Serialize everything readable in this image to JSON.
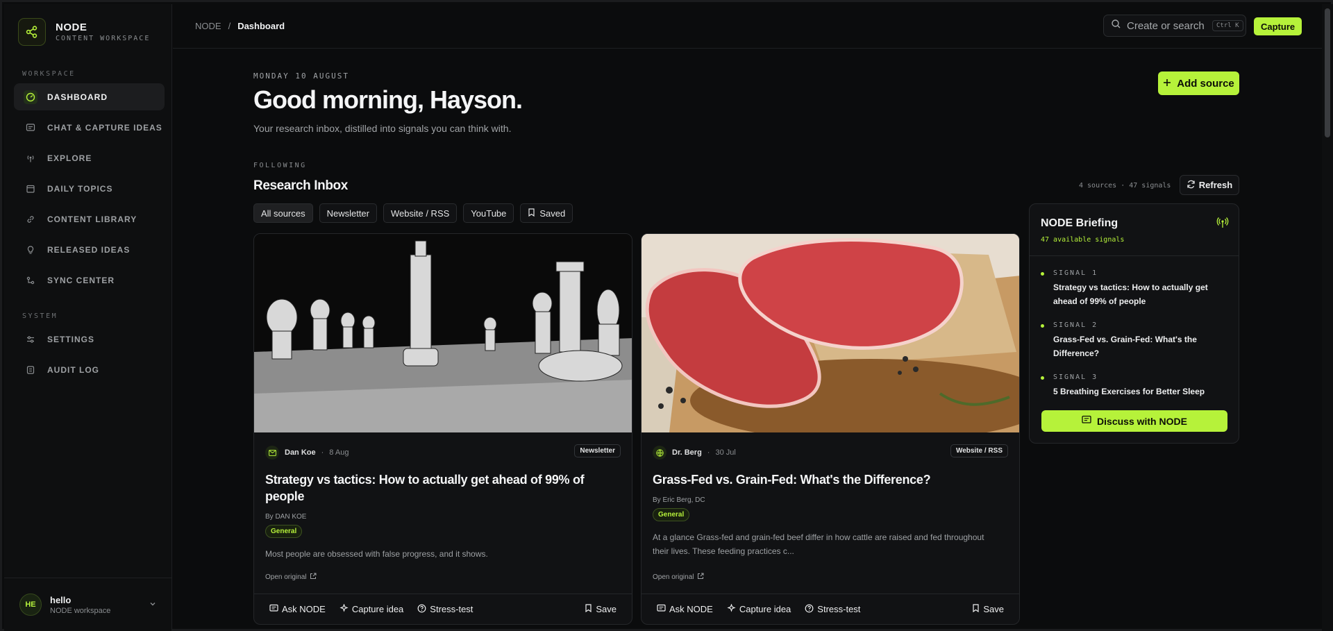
{
  "brand": {
    "name": "NODE",
    "sub": "CONTENT WORKSPACE"
  },
  "sidebar": {
    "workspace_label": "WORKSPACE",
    "system_label": "SYSTEM",
    "items": [
      {
        "label": "DASHBOARD",
        "icon": "gauge-icon"
      },
      {
        "label": "CHAT & CAPTURE IDEAS",
        "icon": "chat-icon"
      },
      {
        "label": "EXPLORE",
        "icon": "broadcast-icon"
      },
      {
        "label": "DAILY TOPICS",
        "icon": "calendar-icon"
      },
      {
        "label": "CONTENT LIBRARY",
        "icon": "link-icon"
      },
      {
        "label": "RELEASED IDEAS",
        "icon": "lightbulb-icon"
      },
      {
        "label": "SYNC CENTER",
        "icon": "sync-icon"
      }
    ],
    "system_items": [
      {
        "label": "SETTINGS",
        "icon": "sliders-icon"
      },
      {
        "label": "AUDIT LOG",
        "icon": "log-icon"
      }
    ]
  },
  "user": {
    "initials": "HE",
    "name": "hello",
    "workspace": "NODE workspace"
  },
  "topbar": {
    "crumb_root": "NODE",
    "crumb_sep": "/",
    "crumb_current": "Dashboard",
    "search_placeholder": "Create or search",
    "search_kbd": "Ctrl K",
    "capture_label": "Capture"
  },
  "main": {
    "date": "MONDAY 10 AUGUST",
    "greeting": "Good morning, Hayson.",
    "subtitle": "Your research inbox, distilled into signals you can think with.",
    "add_source_label": "Add source",
    "following_label": "FOLLOWING",
    "inbox_title": "Research Inbox",
    "stats": "4 sources · 47 signals",
    "refresh_label": "Refresh",
    "filters": [
      "All sources",
      "Newsletter",
      "Website / RSS",
      "YouTube",
      "Saved"
    ]
  },
  "cards": [
    {
      "source": "Dan Koe",
      "date": "8 Aug",
      "badge": "Newsletter",
      "title": "Strategy vs tactics: How to actually get ahead of 99% of people",
      "byline": "By DAN KOE",
      "tag": "General",
      "excerpt": "Most people are obsessed with false progress, and it shows.",
      "open_original": "Open original"
    },
    {
      "source": "Dr. Berg",
      "date": "30 Jul",
      "badge": "Website / RSS",
      "title": "Grass-Fed vs. Grain-Fed: What's the Difference?",
      "byline": "By Eric Berg, DC",
      "tag": "General",
      "excerpt": "At a glance Grass-fed and grain-fed beef differ in how cattle are raised and fed throughout their lives. These feeding practices c...",
      "open_original": "Open original"
    }
  ],
  "card_actions": {
    "ask": "Ask NODE",
    "capture": "Capture idea",
    "stress": "Stress-test",
    "save": "Save"
  },
  "briefing": {
    "title": "NODE Briefing",
    "count": "47 available signals",
    "signals": [
      {
        "label": "SIGNAL 1",
        "title": "Strategy vs tactics: How to actually get ahead of 99% of people"
      },
      {
        "label": "SIGNAL 2",
        "title": "Grass-Fed vs. Grain-Fed: What's the Difference?"
      },
      {
        "label": "SIGNAL 3",
        "title": "5 Breathing Exercises for Better Sleep"
      }
    ],
    "discuss_label": "Discuss with NODE"
  },
  "colors": {
    "accent": "#b6f23a",
    "background": "#0b0c0d",
    "panel": "#111214"
  }
}
